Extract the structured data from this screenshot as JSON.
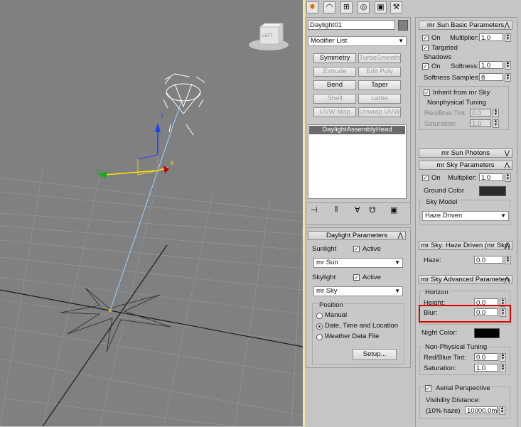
{
  "viewport": {
    "viewcube_label": "LEFT",
    "axis_x": "x",
    "axis_y": "y",
    "axis_z": "z"
  },
  "command_panel": {
    "tabs": [
      "create-icon",
      "modify-icon",
      "hierarchy-icon",
      "motion-icon",
      "display-icon",
      "utilities-icon"
    ],
    "object_name": "Daylight01",
    "modifier_list": "Modifier List",
    "modifier_buttons": [
      {
        "label": "Symmetry",
        "enabled": true
      },
      {
        "label": "TurboSmooth",
        "enabled": false
      },
      {
        "label": "Extrude",
        "enabled": false
      },
      {
        "label": "Edit Poly",
        "enabled": false
      },
      {
        "label": "Bend",
        "enabled": true
      },
      {
        "label": "Taper",
        "enabled": true
      },
      {
        "label": "Shell",
        "enabled": false
      },
      {
        "label": "Lathe",
        "enabled": false
      },
      {
        "label": "UVW Map",
        "enabled": false
      },
      {
        "label": "Unwrap UVW",
        "enabled": false
      }
    ],
    "stack_item": "DaylightAssemblyHead"
  },
  "daylight_params": {
    "title": "Daylight Parameters",
    "sunlight_label": "Sunlight",
    "sunlight_active": "Active",
    "sun_value": "mr Sun",
    "skylight_label": "Skylight",
    "skylight_active": "Active",
    "sky_value": "mr Sky",
    "position_label": "Position",
    "options": [
      "Manual",
      "Date, Time and Location",
      "Weather Data File"
    ],
    "selected_option": 1,
    "setup_button": "Setup..."
  },
  "mr_sun_basic": {
    "title": "mr Sun Basic Parameters",
    "on_label": "On",
    "multiplier_label": "Multiplier:",
    "multiplier_value": "1.0",
    "targeted_label": "Targeted",
    "shadows_label": "Shadows",
    "shadows_on_label": "On",
    "softness_label": "Softness:",
    "softness_value": "1.0",
    "softness_samples_label": "Softness Samples:",
    "softness_samples_value": "8",
    "inherit_label": "Inherit from mr Sky",
    "nonphysical_label": "Nonphysical Tuning",
    "redblue_label": "Red/Blue Tint:",
    "redblue_value": "0.0",
    "saturation_label": "Saturation:",
    "saturation_value": "1.0"
  },
  "rollouts": {
    "sun_photons": "mr Sun Photons",
    "sky_params": "mr Sky Parameters",
    "haze_driven": "mr Sky: Haze Driven (mr Sky)",
    "sky_advanced": "mr Sky Advanced Parameters"
  },
  "mr_sky": {
    "on_label": "On",
    "multiplier_label": "Multiplier:",
    "multiplier_value": "1.0",
    "ground_color_label": "Ground Color",
    "ground_color": "#2b2b2b",
    "sky_model_label": "Sky Model",
    "sky_model_value": "Haze Driven"
  },
  "haze": {
    "haze_label": "Haze:",
    "haze_value": "0.0"
  },
  "advanced": {
    "horizon_label": "Horizon",
    "height_label": "Height:",
    "height_value": "0.0",
    "blur_label": "Blur:",
    "blur_value": "0.0",
    "night_color_label": "Night Color:",
    "night_color": "#000000",
    "nonphysical_label": "Non-Physical Tuning",
    "redblue_label": "Red/Blue Tint:",
    "redblue_value": "0.0",
    "saturation_label": "Saturation:",
    "saturation_value": "1.0",
    "aerial_label": "Aerial Perspective",
    "visibility_label": "Visibility Distance:",
    "haze_pct_label": "(10% haze)",
    "visibility_value": "10000.0m"
  },
  "colors": {
    "highlight": "#e00000",
    "viewport_bg": "#808080",
    "sun_ray": "#9fd4ff",
    "stack_selected": "#6b6b6b"
  }
}
